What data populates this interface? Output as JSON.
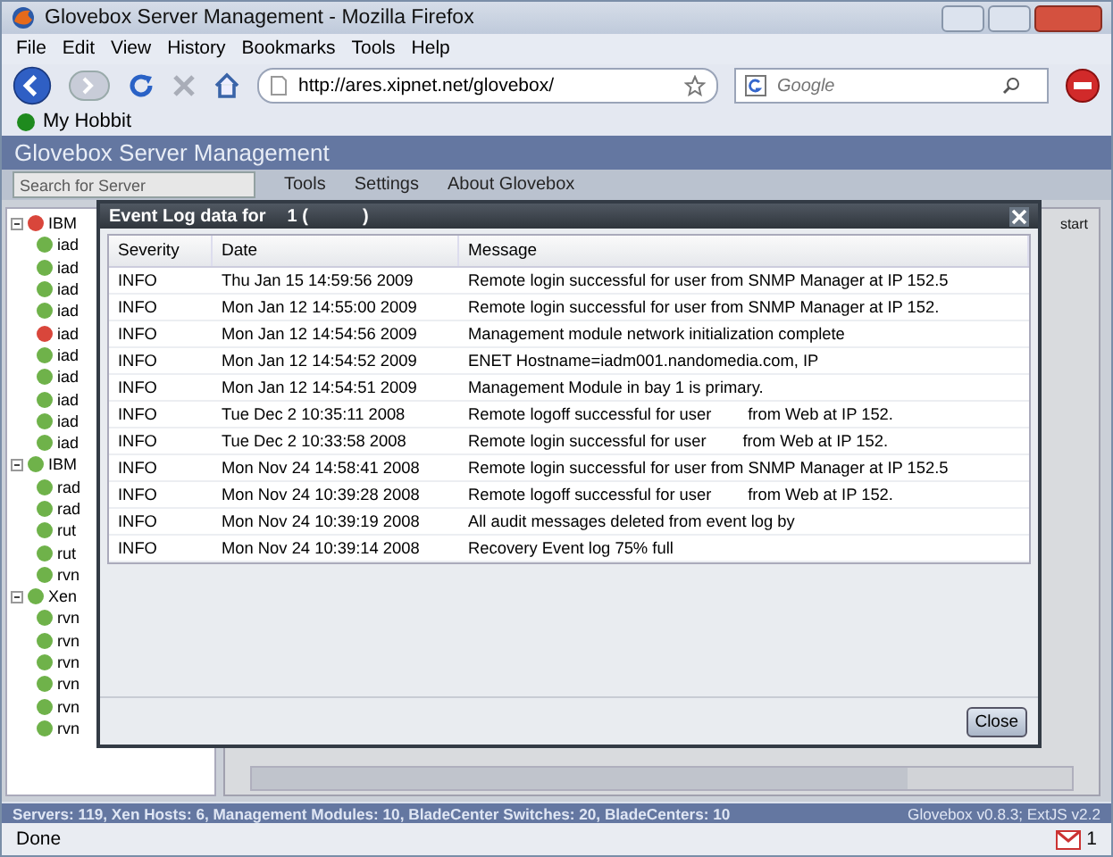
{
  "window": {
    "title": "Glovebox Server Management - Mozilla Firefox"
  },
  "menu": [
    "File",
    "Edit",
    "View",
    "History",
    "Bookmarks",
    "Tools",
    "Help"
  ],
  "address": {
    "value": "http://ares.xipnet.net/glovebox/"
  },
  "search": {
    "placeholder": "Google"
  },
  "bookmarks": [
    "My Hobbit"
  ],
  "app": {
    "title": "Glovebox Server Management",
    "search_placeholder": "Search for Server",
    "toolbar": [
      "Tools",
      "Settings",
      "About Glovebox"
    ],
    "right_panel_text": "start"
  },
  "tree": [
    {
      "label": "IBM",
      "color": "#d9463b",
      "expanded": true,
      "children": [
        {
          "label": "iad",
          "color": "#6fb24a"
        },
        {
          "label": "iad",
          "color": "#6fb24a"
        },
        {
          "label": "iad",
          "color": "#6fb24a"
        },
        {
          "label": "iad",
          "color": "#6fb24a"
        },
        {
          "label": "iad",
          "color": "#d9463b"
        },
        {
          "label": "iad",
          "color": "#6fb24a"
        },
        {
          "label": "iad",
          "color": "#6fb24a"
        },
        {
          "label": "iad",
          "color": "#6fb24a"
        },
        {
          "label": "iad",
          "color": "#6fb24a"
        },
        {
          "label": "iad",
          "color": "#6fb24a"
        }
      ]
    },
    {
      "label": "IBM",
      "color": "#6fb24a",
      "expanded": true,
      "children": [
        {
          "label": "rad",
          "color": "#6fb24a"
        },
        {
          "label": "rad",
          "color": "#6fb24a"
        },
        {
          "label": "rut",
          "color": "#6fb24a"
        },
        {
          "label": "rut",
          "color": "#6fb24a"
        },
        {
          "label": "rvn",
          "color": "#6fb24a"
        }
      ]
    },
    {
      "label": "Xen",
      "color": "#6fb24a",
      "expanded": true,
      "children": [
        {
          "label": "rvn",
          "color": "#6fb24a"
        },
        {
          "label": "rvn",
          "color": "#6fb24a"
        },
        {
          "label": "rvn",
          "color": "#6fb24a"
        },
        {
          "label": "rvn",
          "color": "#6fb24a"
        },
        {
          "label": "rvn",
          "color": "#6fb24a"
        },
        {
          "label": "rvn",
          "color": "#6fb24a"
        }
      ]
    }
  ],
  "dialog": {
    "title": "Event Log data for",
    "title_suffix": "1 (           )",
    "columns": [
      "Severity",
      "Date",
      "Message"
    ],
    "rows": [
      [
        "INFO",
        "Thu Jan 15 14:59:56 2009",
        "Remote login successful for user from SNMP Manager at IP 152.5"
      ],
      [
        "INFO",
        "Mon Jan 12 14:55:00 2009",
        "Remote login successful for user from SNMP Manager at IP 152."
      ],
      [
        "INFO",
        "Mon Jan 12 14:54:56 2009",
        "Management module network initialization complete"
      ],
      [
        "INFO",
        "Mon Jan 12 14:54:52 2009",
        "ENET Hostname=iadm001.nandomedia.com, IP"
      ],
      [
        "INFO",
        "Mon Jan 12 14:54:51 2009",
        "Management Module in bay 1 is primary."
      ],
      [
        "INFO",
        "Tue Dec 2 10:35:11 2008",
        "Remote logoff successful for user        from Web at IP 152."
      ],
      [
        "INFO",
        "Tue Dec 2 10:33:58 2008",
        "Remote login successful for user        from Web at IP 152."
      ],
      [
        "INFO",
        "Mon Nov 24 14:58:41 2008",
        "Remote login successful for user from SNMP Manager at IP 152.5"
      ],
      [
        "INFO",
        "Mon Nov 24 10:39:28 2008",
        "Remote logoff successful for user        from Web at IP 152."
      ],
      [
        "INFO",
        "Mon Nov 24 10:39:19 2008",
        "All audit messages deleted from event log by"
      ],
      [
        "INFO",
        "Mon Nov 24 10:39:14 2008",
        "Recovery Event log 75% full"
      ]
    ],
    "close_button": "Close"
  },
  "app_status": {
    "summary": "Servers: 119, Xen Hosts: 6, Management Modules: 10, BladeCenter Switches: 20, BladeCenters: 10",
    "version": "Glovebox v0.8.3; ExtJS v2.2"
  },
  "status_bar": {
    "text": "Done",
    "mail_count": "1"
  }
}
